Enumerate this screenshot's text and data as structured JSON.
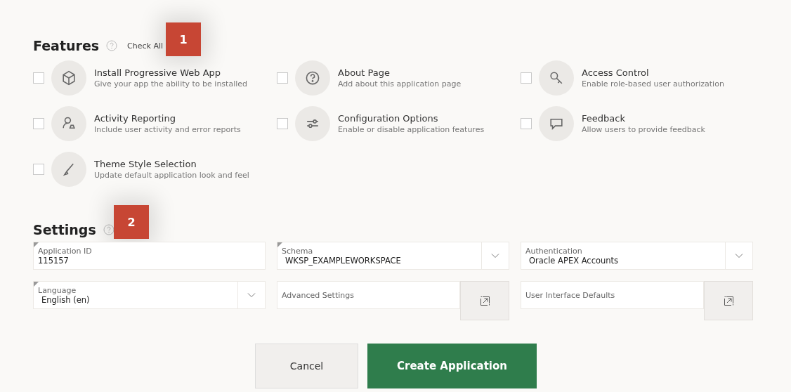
{
  "features": {
    "title": "Features",
    "check_all": "Check All",
    "callout": "1",
    "items": [
      {
        "kind": "cube",
        "title": "Install Progressive Web App",
        "description": "Give your app the ability to be installed",
        "checked": false
      },
      {
        "kind": "help",
        "title": "About Page",
        "description": "Add about this application page",
        "checked": false
      },
      {
        "kind": "key",
        "title": "Access Control",
        "description": "Enable role-based user authorization",
        "checked": false
      },
      {
        "kind": "user",
        "title": "Activity Reporting",
        "description": "Include user activity and error reports",
        "checked": false
      },
      {
        "kind": "sliders",
        "title": "Configuration Options",
        "description": "Enable or disable application features",
        "checked": false
      },
      {
        "kind": "chat",
        "title": "Feedback",
        "description": "Allow users to provide feedback",
        "checked": false
      },
      {
        "kind": "brush",
        "title": "Theme Style Selection",
        "description": "Update default application look and feel",
        "checked": false
      }
    ]
  },
  "settings": {
    "title": "Settings",
    "callout": "2",
    "fields": [
      {
        "kind": "text",
        "label": "Application ID",
        "value": "115157",
        "required": true
      },
      {
        "kind": "select",
        "label": "Schema",
        "value": "WKSP_EXAMPLEWORKSPACE",
        "required": true
      },
      {
        "kind": "select",
        "label": "Authentication",
        "value": "Oracle APEX Accounts",
        "required": false
      },
      {
        "kind": "select",
        "label": "Language",
        "value": "English (en)",
        "required": true
      },
      {
        "kind": "popup",
        "label": "Advanced Settings",
        "required": false
      },
      {
        "kind": "popup",
        "label": "User Interface Defaults",
        "required": false
      }
    ]
  },
  "buttons": [
    {
      "label": "Cancel",
      "kind": "secondary"
    },
    {
      "label": "Create Application",
      "kind": "primary"
    }
  ]
}
